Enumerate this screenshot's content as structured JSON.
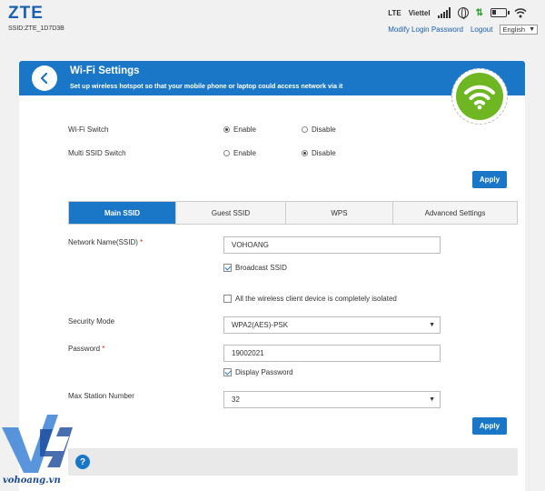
{
  "header": {
    "brand": "ZTE",
    "ssid": "SSID:ZTE_1D7D3B",
    "network_type": "LTE",
    "carrier": "Viettel",
    "icons": [
      "signal-bars-icon",
      "globe-icon",
      "data-arrows-icon",
      "battery-icon",
      "wifi-icon"
    ],
    "modify_login_password": "Modify Login Password",
    "logout": "Logout",
    "language": "English"
  },
  "panel": {
    "title": "Wi-Fi Settings",
    "subtitle": "Set up wireless hotspot so that your mobile phone or laptop could access network via it",
    "accent_color": "#1a77c8",
    "badge_color": "#6fb722"
  },
  "wifi_switch": {
    "label": "Wi-Fi Switch",
    "options": [
      "Enable",
      "Disable"
    ],
    "selected": "Enable"
  },
  "multi_ssid_switch": {
    "label": "Multi SSID Switch",
    "options": [
      "Enable",
      "Disable"
    ],
    "selected": "Disable"
  },
  "apply_label": "Apply",
  "tabs": [
    {
      "label": "Main SSID",
      "active": true
    },
    {
      "label": "Guest SSID",
      "active": false
    },
    {
      "label": "WPS",
      "active": false
    },
    {
      "label": "Advanced Settings",
      "active": false
    }
  ],
  "form": {
    "network_name_label": "Network Name(SSID)",
    "network_name_value": "VOHOANG",
    "broadcast_ssid_label": "Broadcast SSID",
    "broadcast_ssid_checked": true,
    "isolate_label": "All the wireless client device is completely isolated",
    "isolate_checked": false,
    "security_mode_label": "Security Mode",
    "security_mode_value": "WPA2(AES)-PSK",
    "password_label": "Password",
    "password_value": "19002021",
    "display_password_label": "Display Password",
    "display_password_checked": true,
    "max_station_label": "Max Station Number",
    "max_station_value": "32",
    "required_mark": "*"
  },
  "watermark": {
    "text": "vohoang.vn"
  }
}
